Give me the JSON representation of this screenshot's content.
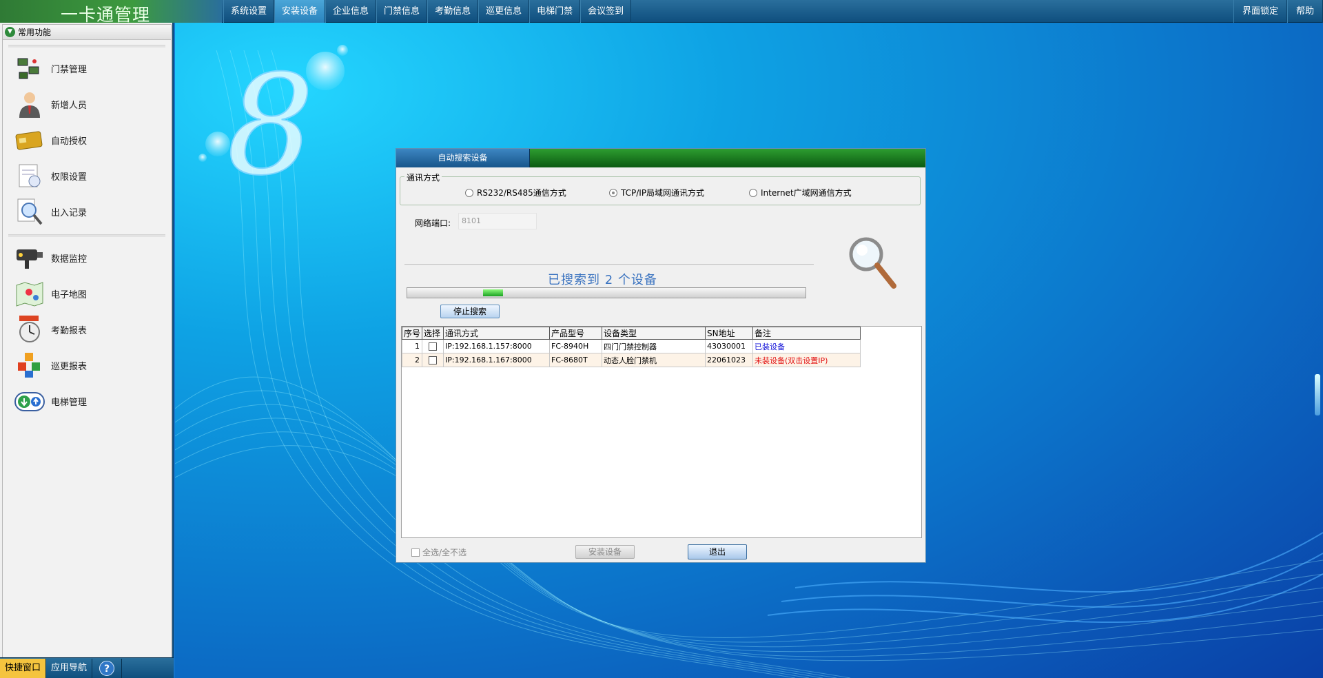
{
  "app": {
    "title": "一卡通管理"
  },
  "top_menu": [
    {
      "label": "系统设置"
    },
    {
      "label": "安装设备",
      "active": true
    },
    {
      "label": "企业信息"
    },
    {
      "label": "门禁信息"
    },
    {
      "label": "考勤信息"
    },
    {
      "label": "巡更信息"
    },
    {
      "label": "电梯门禁"
    },
    {
      "label": "会议签到"
    }
  ],
  "top_right": {
    "lock_label": "界面锁定",
    "help_label": "帮助"
  },
  "sidebar": {
    "header": "常用功能",
    "items": [
      {
        "label": "门禁管理",
        "icon": "access-control-icon"
      },
      {
        "label": "新增人员",
        "icon": "person-icon"
      },
      {
        "label": "自动授权",
        "icon": "card-icon"
      },
      {
        "label": "权限设置",
        "icon": "permission-icon"
      },
      {
        "label": "出入记录",
        "icon": "magnifier-doc-icon"
      },
      {
        "label": "数据监控",
        "icon": "camera-icon"
      },
      {
        "label": "电子地图",
        "icon": "map-icon"
      },
      {
        "label": "考勤报表",
        "icon": "clock-icon"
      },
      {
        "label": "巡更报表",
        "icon": "cubes-icon"
      },
      {
        "label": "电梯管理",
        "icon": "elevator-icon"
      }
    ],
    "footer_tabs": {
      "shortcut": "快捷窗口",
      "nav": "应用导航",
      "help": "?"
    }
  },
  "dialog": {
    "title": "自动搜索设备",
    "comm_group_label": "通讯方式",
    "radios": [
      {
        "label": "RS232/RS485通信方式",
        "checked": false
      },
      {
        "label": "TCP/IP局域网通讯方式",
        "checked": true
      },
      {
        "label": "Internet广域网通信方式",
        "checked": false
      }
    ],
    "port_label": "网络端口:",
    "port_value": "8101",
    "search_status": "已搜索到  2 个设备",
    "progress": 0.09,
    "stop_button": "停止搜索",
    "table": {
      "headers": [
        "序号",
        "选择",
        "通讯方式",
        "产品型号",
        "设备类型",
        "SN地址",
        "备注"
      ],
      "rows": [
        {
          "seq": "1",
          "comm": "IP:192.168.1.157:8000",
          "model": "FC-8940H",
          "type": "四门门禁控制器",
          "sn": "43030001",
          "note": "已装设备",
          "status": "installed"
        },
        {
          "seq": "2",
          "comm": "IP:192.168.1.167:8000",
          "model": "FC-8680T",
          "type": "动态人脸门禁机",
          "sn": "22061023",
          "note": "未装设备(双击设置IP)",
          "status": "uninstalled"
        }
      ]
    },
    "select_all_label": "全选/全不选",
    "install_button": "安装设备",
    "exit_button": "退出"
  },
  "colors": {
    "accent_green": "#2d9d30",
    "accent_blue": "#17558b",
    "installed": "#1010d8",
    "uninstalled": "#e21212"
  }
}
